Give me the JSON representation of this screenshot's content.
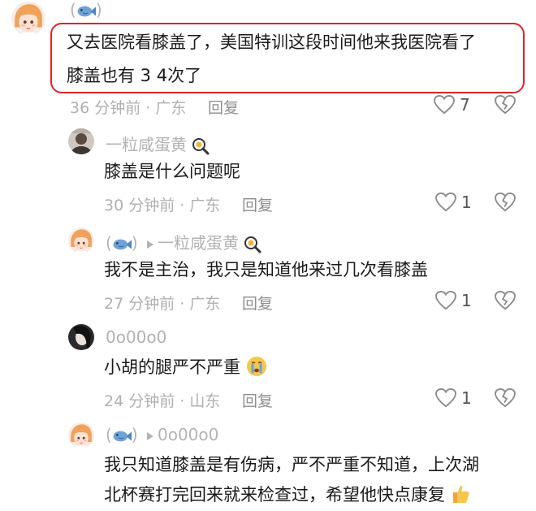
{
  "comments": [
    {
      "author_paren_open": "(",
      "author_paren_close": ")",
      "text_line1": "又去医院看膝盖了，美国特训这段时间他来我医院看了",
      "text_line2": "膝盖也有 3  4次了",
      "meta": "36 分钟前 · 广东",
      "reply": "回复",
      "likes": "7"
    },
    {
      "author": "一粒咸蛋黄",
      "text": "膝盖是什么问题呢",
      "meta": "30 分钟前 · 广东",
      "reply": "回复",
      "likes": "1"
    },
    {
      "author_paren_open": "(",
      "author_paren_close": ")",
      "reply_to": "一粒咸蛋黄",
      "text": "我不是主治，我只是知道他来过几次看膝盖",
      "meta": "27 分钟前 · 广东",
      "reply": "回复",
      "likes": "1"
    },
    {
      "author": "0o00o0",
      "text": "小胡的腿严不严重",
      "meta": "24 分钟前 · 山东",
      "reply": "回复",
      "likes": "1"
    },
    {
      "author_paren_open": "(",
      "author_paren_close": ")",
      "reply_to": "0o00o0",
      "text_line1": "我只知道膝盖是有伤病，严不严重不知道，上次湖",
      "text_line2": "北杯赛打完回来就来检查过，希望他快点康复"
    }
  ],
  "colors": {
    "highlight": "#d9262b",
    "meta": "#b0b0b0",
    "name": "#b3b3b3"
  },
  "icons": [
    "fish-emoji-icon",
    "magnifier-egg-emoji-icon",
    "crying-face-emoji-icon",
    "thumbs-up-emoji-icon",
    "heart-icon",
    "broken-heart-icon",
    "play-arrow-icon"
  ]
}
